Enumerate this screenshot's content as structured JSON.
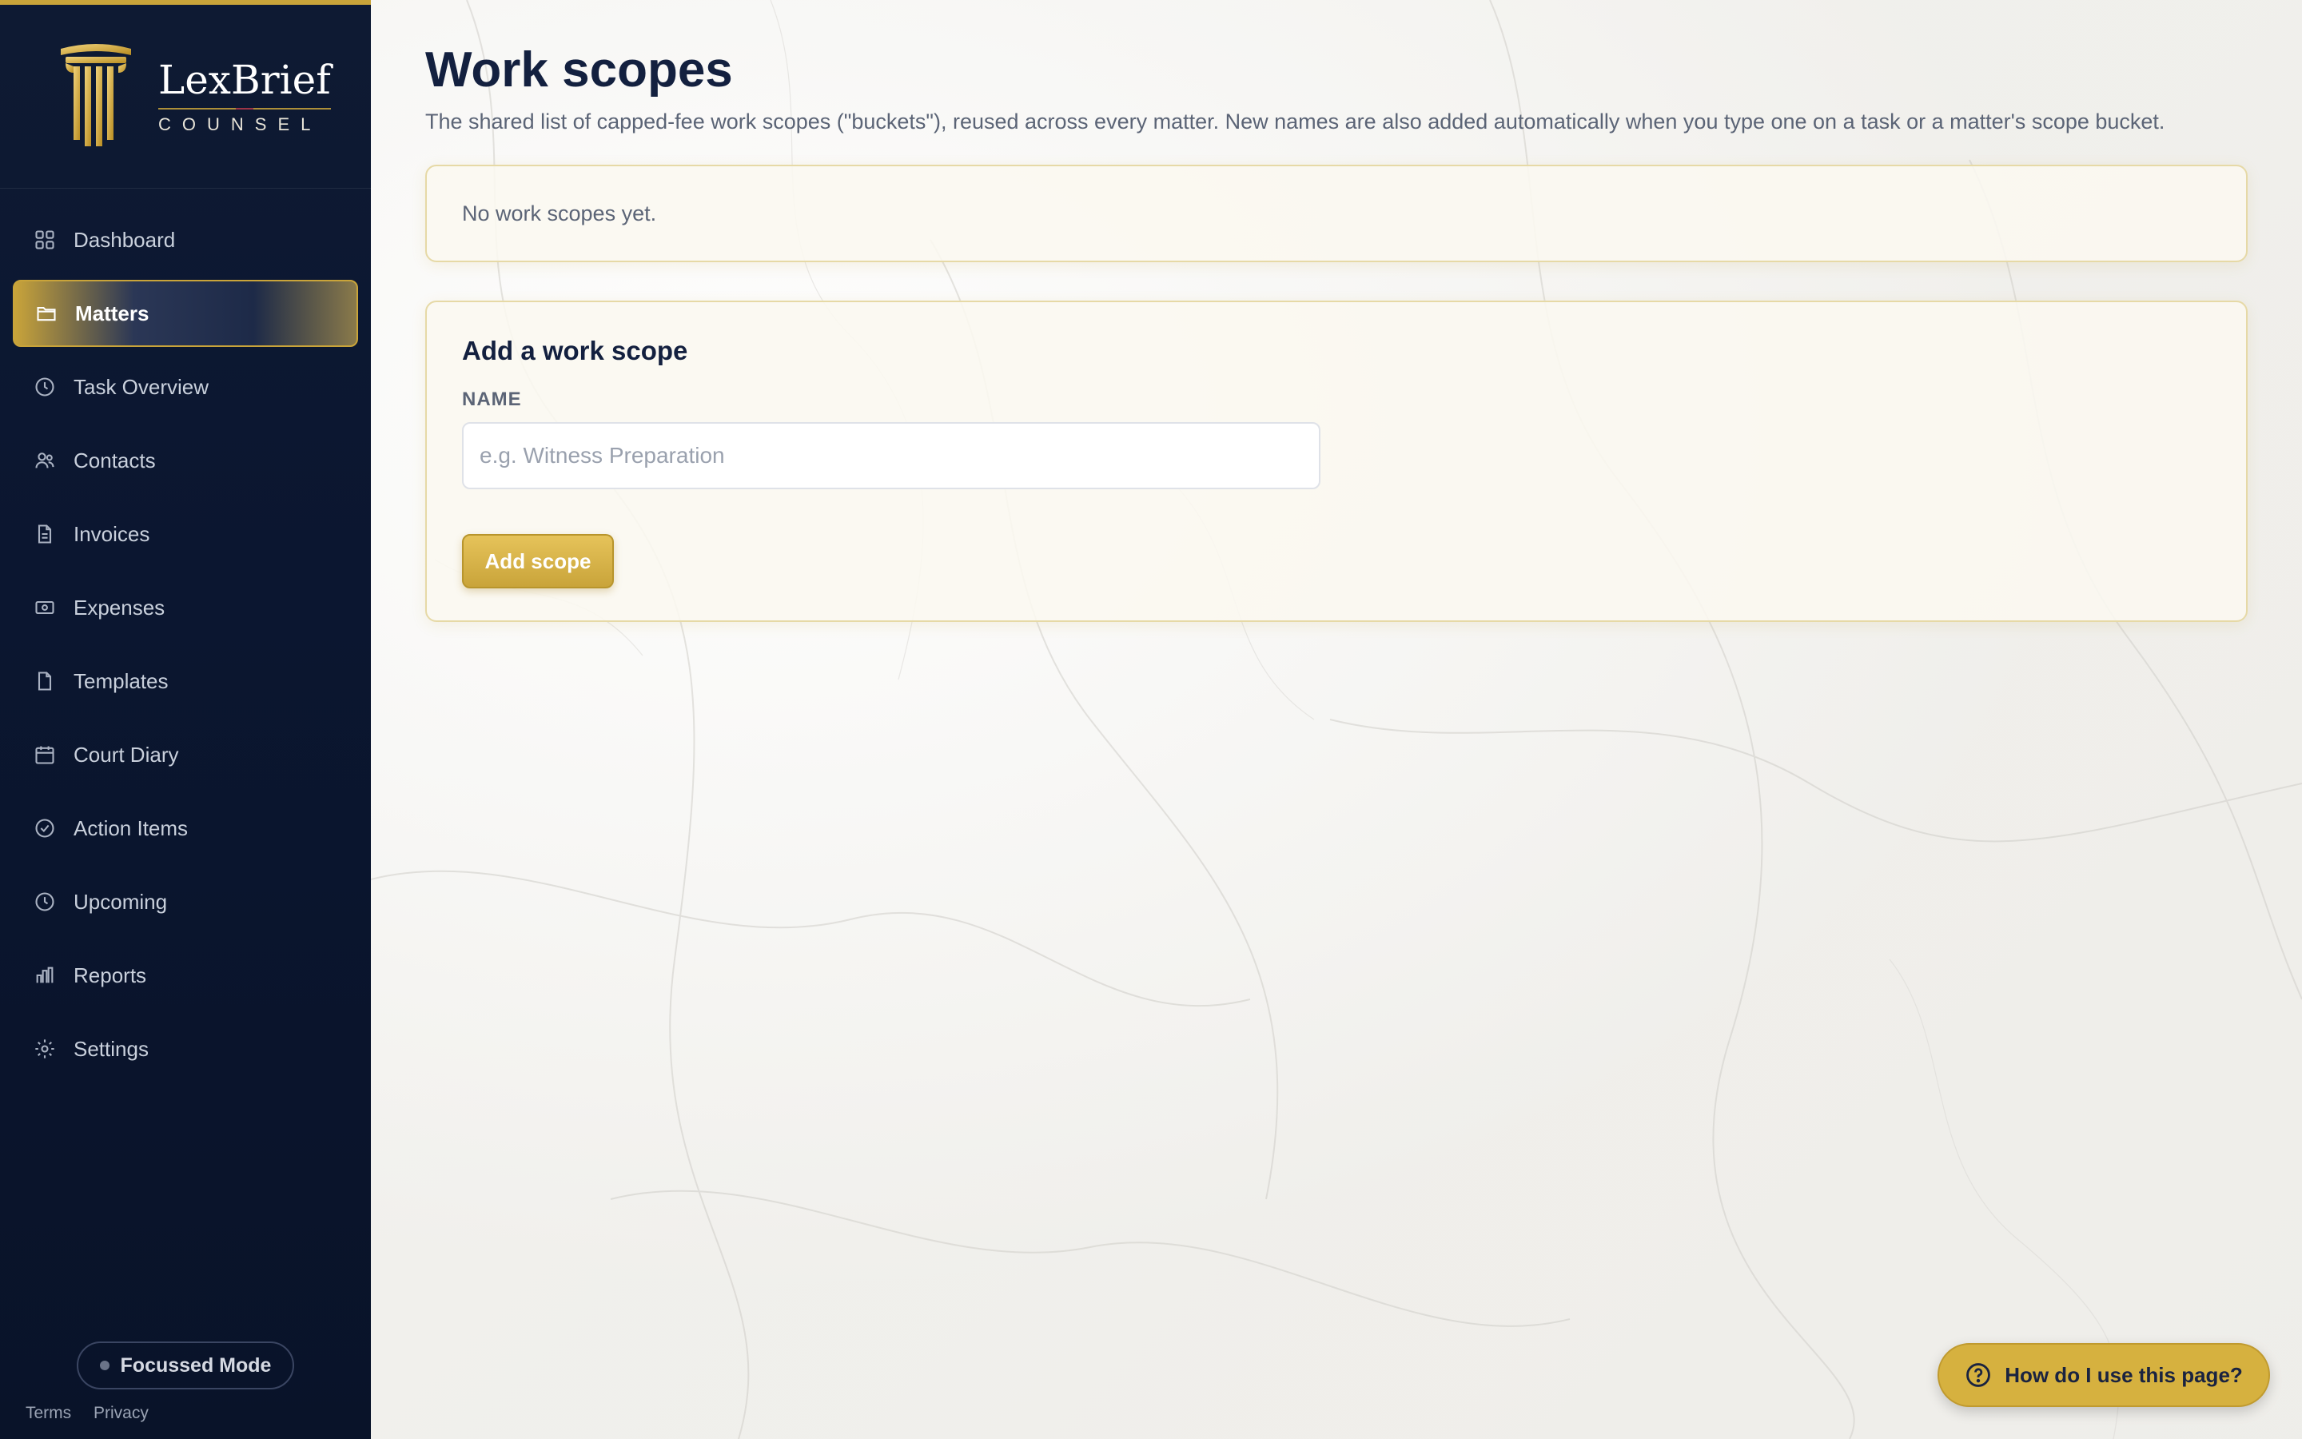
{
  "brand": {
    "name": "LexBrief",
    "subtitle": "COUNSEL",
    "accent_color": "#c9a43a",
    "sidebar_color": "#0e1a33"
  },
  "sidebar": {
    "items": [
      {
        "label": "Dashboard",
        "icon": "grid-icon"
      },
      {
        "label": "Matters",
        "icon": "folder-icon",
        "active": true
      },
      {
        "label": "Task Overview",
        "icon": "clock-icon"
      },
      {
        "label": "Contacts",
        "icon": "users-icon"
      },
      {
        "label": "Invoices",
        "icon": "document-icon"
      },
      {
        "label": "Expenses",
        "icon": "banknote-icon"
      },
      {
        "label": "Templates",
        "icon": "file-icon"
      },
      {
        "label": "Court Diary",
        "icon": "calendar-icon"
      },
      {
        "label": "Action Items",
        "icon": "check-circle-icon"
      },
      {
        "label": "Upcoming",
        "icon": "clock-icon"
      },
      {
        "label": "Reports",
        "icon": "bar-chart-icon"
      },
      {
        "label": "Settings",
        "icon": "gear-icon"
      }
    ],
    "focus_mode_label": "Focussed Mode",
    "footer": {
      "terms": "Terms",
      "privacy": "Privacy"
    }
  },
  "main": {
    "title": "Work scopes",
    "subtitle": "The shared list of capped-fee work scopes (\"buckets\"), reused across every matter. New names are also added automatically when you type one on a task or a matter's scope bucket.",
    "empty_message": "No work scopes yet.",
    "form": {
      "title": "Add a work scope",
      "name_label": "NAME",
      "name_placeholder": "e.g. Witness Preparation",
      "name_value": "",
      "submit_label": "Add scope"
    }
  },
  "help": {
    "label": "How do I use this page?"
  }
}
